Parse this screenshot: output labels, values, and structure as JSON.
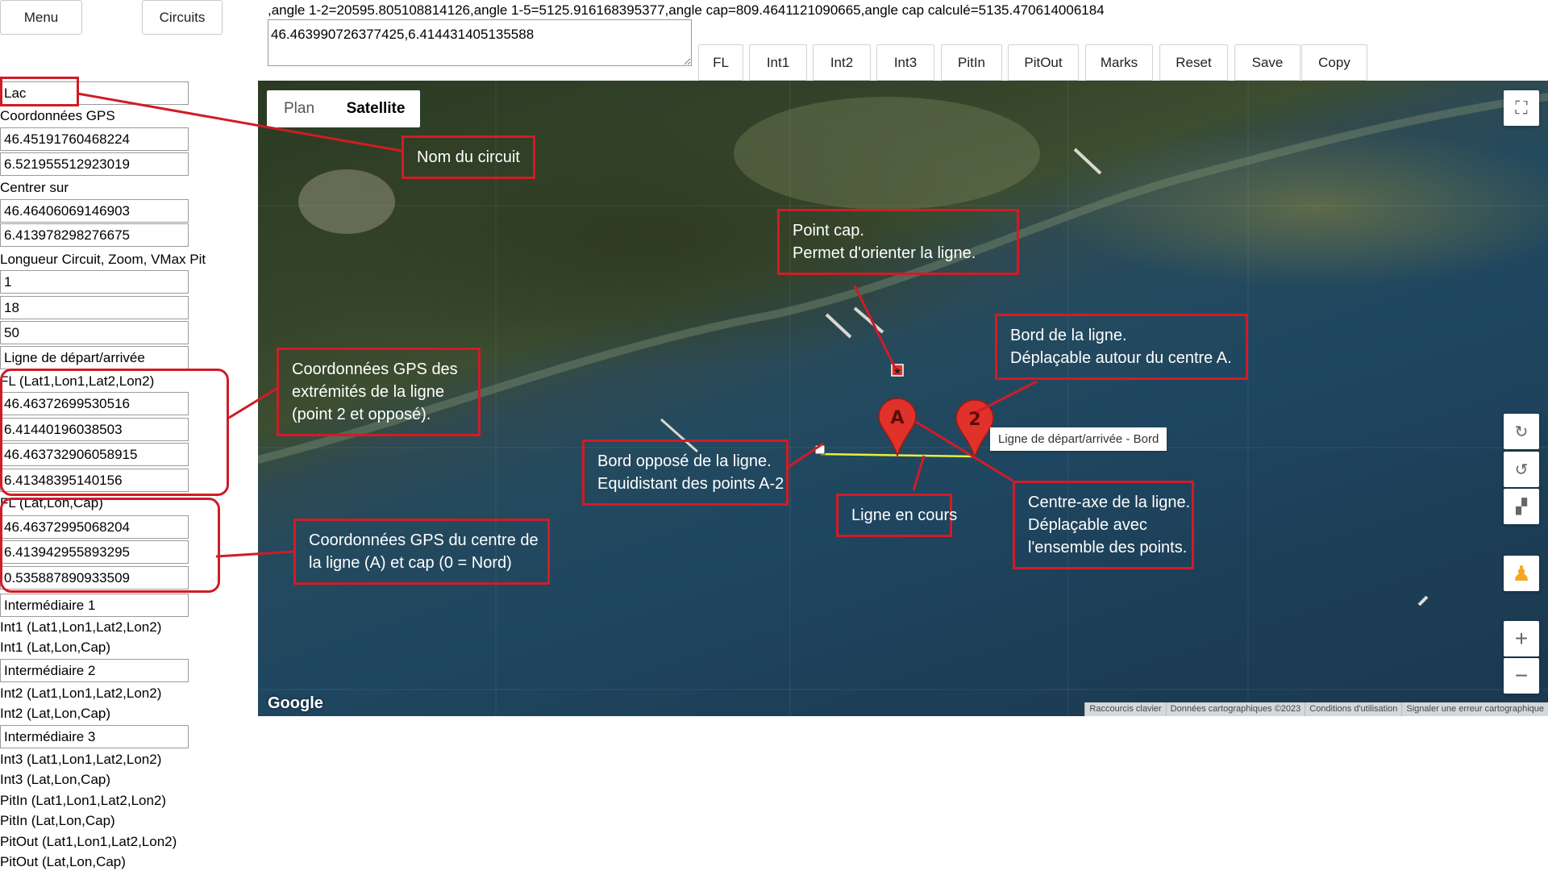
{
  "header": {
    "menu_label": "Menu",
    "circuits_label": "Circuits",
    "info_text": ",angle 1-2=20595.805108814126,angle 1-5=5125.916168395377,angle cap=809.4641121090665,angle cap calculé=5135.470614006184",
    "coords_value": "46.463990726377425,6.414431405135588"
  },
  "toolbar": {
    "fl": "FL",
    "int1": "Int1",
    "int2": "Int2",
    "int3": "Int3",
    "pitin": "PitIn",
    "pitout": "PitOut",
    "marks": "Marks",
    "reset": "Reset",
    "save": "Save",
    "copy": "Copy"
  },
  "sidebar": {
    "circuit_name": "Lac",
    "gps_label": "Coordonnées GPS",
    "gps_lat": "46.45191760468224",
    "gps_lon": "6.521955512923019",
    "center_label": "Centrer sur",
    "center_lat": "46.46406069146903",
    "center_lon": "6.413978298276675",
    "length_label": "Longueur Circuit, Zoom, VMax Pit",
    "length": "1",
    "zoom": "18",
    "vmax": "50",
    "line_name": "Ligne de départ/arrivée",
    "fl_ends_label": "FL (Lat1,Lon1,Lat2,Lon2)",
    "fl_lat1": "46.46372699530516",
    "fl_lon1": "6.41440196038503",
    "fl_lat2": "46.463732906058915",
    "fl_lon2": "6.41348395140156",
    "fl_center_label": "FL (Lat,Lon,Cap)",
    "fl_center_lat": "46.46372995068204",
    "fl_center_lon": "6.413942955893295",
    "fl_cap": "0.535887890933509",
    "int1_name": "Intermédiaire 1",
    "int1_ends_label": "Int1 (Lat1,Lon1,Lat2,Lon2)",
    "int1_center_label": "Int1 (Lat,Lon,Cap)",
    "int2_name": "Intermédiaire 2",
    "int2_ends_label": "Int2 (Lat1,Lon1,Lat2,Lon2)",
    "int2_center_label": "Int2 (Lat,Lon,Cap)",
    "int3_name": "Intermédiaire 3",
    "int3_ends_label": "Int3 (Lat1,Lon1,Lat2,Lon2)",
    "int3_center_label": "Int3 (Lat,Lon,Cap)",
    "pitin_ends_label": "PitIn (Lat1,Lon1,Lat2,Lon2)",
    "pitin_center_label": "PitIn (Lat,Lon,Cap)",
    "pitout_ends_label": "PitOut (Lat1,Lon1,Lat2,Lon2)",
    "pitout_center_label": "PitOut (Lat,Lon,Cap)"
  },
  "map": {
    "tab_plan": "Plan",
    "tab_satellite": "Satellite",
    "marker_a": "A",
    "marker_2": "2",
    "tooltip": "Ligne de départ/arrivée - Bord",
    "google": "Google",
    "footer": [
      "Raccourcis clavier",
      "Données cartographiques ©2023",
      "Conditions d'utilisation",
      "Signaler une erreur cartographique"
    ],
    "line_color": "#e8f03a",
    "marker_color": "#e0312a"
  },
  "annotations": {
    "nom_circuit": "Nom du circuit",
    "point_cap_1": "Point cap.",
    "point_cap_2": "Permet d'orienter la ligne.",
    "bord_1": "Bord de la ligne.",
    "bord_2": "Déplaçable autour du centre A.",
    "coord_ext_1": "Coordonnées GPS des",
    "coord_ext_2": "extrémités de la ligne",
    "coord_ext_3": "(point 2 et opposé).",
    "bord_oppose_1": "Bord opposé de la ligne.",
    "bord_oppose_2": "Equidistant des points A-2",
    "ligne_cours": "Ligne en cours",
    "centre_1": "Centre-axe de la ligne.",
    "centre_2": "Déplaçable avec",
    "centre_3": "l'ensemble des points.",
    "coord_centre_1": "Coordonnées GPS du centre de",
    "coord_centre_2": "la ligne (A) et cap (0 = Nord)",
    "color": "#d01c26"
  }
}
